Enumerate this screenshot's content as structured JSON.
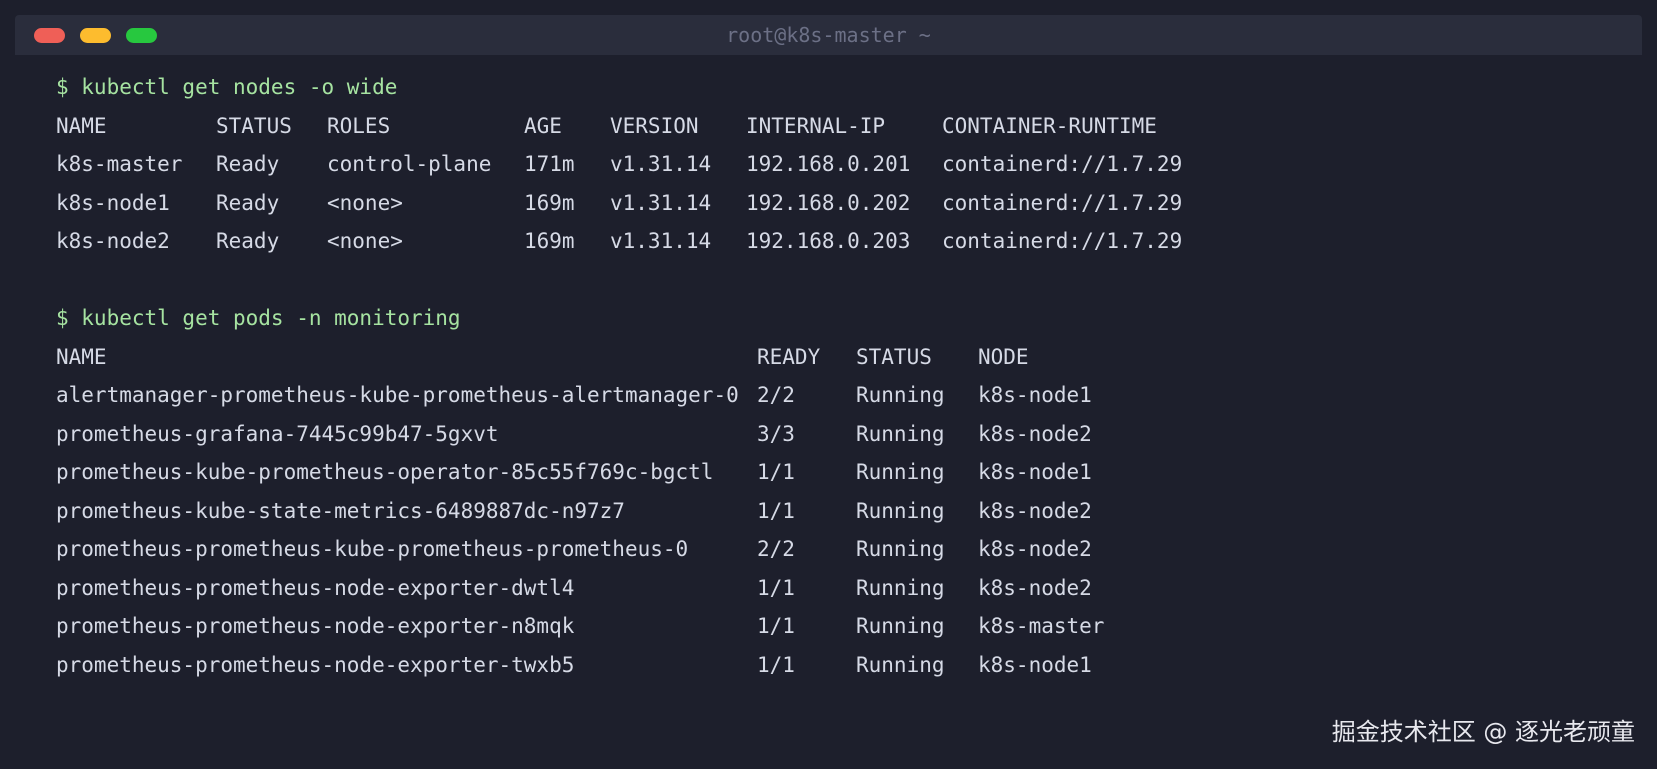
{
  "window": {
    "title": "root@k8s-master ~"
  },
  "nodes_section": {
    "command": "$ kubectl get nodes -o wide",
    "headers": [
      "NAME",
      "STATUS",
      "ROLES",
      "AGE",
      "VERSION",
      "INTERNAL-IP",
      "CONTAINER-RUNTIME"
    ],
    "rows": [
      [
        "k8s-master",
        "Ready",
        "control-plane",
        "171m",
        "v1.31.14",
        "192.168.0.201",
        "containerd://1.7.29"
      ],
      [
        "k8s-node1",
        "Ready",
        "<none>",
        "169m",
        "v1.31.14",
        "192.168.0.202",
        "containerd://1.7.29"
      ],
      [
        "k8s-node2",
        "Ready",
        "<none>",
        "169m",
        "v1.31.14",
        "192.168.0.203",
        "containerd://1.7.29"
      ]
    ]
  },
  "pods_section": {
    "command": "$ kubectl get pods -n monitoring",
    "headers": [
      "NAME",
      "READY",
      "STATUS",
      "NODE"
    ],
    "rows": [
      [
        "alertmanager-prometheus-kube-prometheus-alertmanager-0",
        "2/2",
        "Running",
        "k8s-node1"
      ],
      [
        "prometheus-grafana-7445c99b47-5gxvt",
        "3/3",
        "Running",
        "k8s-node2"
      ],
      [
        "prometheus-kube-prometheus-operator-85c55f769c-bgctl",
        "1/1",
        "Running",
        "k8s-node1"
      ],
      [
        "prometheus-kube-state-metrics-6489887dc-n97z7",
        "1/1",
        "Running",
        "k8s-node2"
      ],
      [
        "prometheus-prometheus-kube-prometheus-prometheus-0",
        "2/2",
        "Running",
        "k8s-node2"
      ],
      [
        "prometheus-prometheus-node-exporter-dwtl4",
        "1/1",
        "Running",
        "k8s-node2"
      ],
      [
        "prometheus-prometheus-node-exporter-n8mqk",
        "1/1",
        "Running",
        "k8s-master"
      ],
      [
        "prometheus-prometheus-node-exporter-twxb5",
        "1/1",
        "Running",
        "k8s-node1"
      ]
    ]
  },
  "watermark": "掘金技术社区 @ 逐光老顽童",
  "colors": {
    "background": "#1d1f2c",
    "titlebar": "#2a2d3c",
    "text": "#d6dae6",
    "command": "#a6e3a1",
    "close": "#ef5f57",
    "minimize": "#fdbc2e",
    "maximize": "#27c83f"
  }
}
